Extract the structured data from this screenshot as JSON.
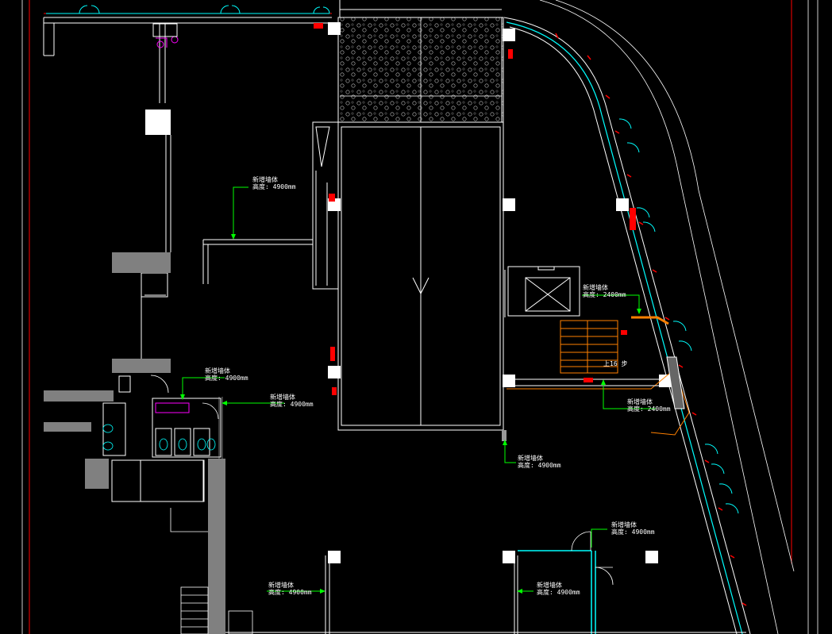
{
  "annotations": [
    {
      "id": "a1",
      "line1": "新增墙体",
      "line2": "高度: 4900mm"
    },
    {
      "id": "a2",
      "line1": "新增墙体",
      "line2": "高度: 2400mm"
    },
    {
      "id": "a3",
      "line1": "新增墙体",
      "line2": "高度: 4900mm"
    },
    {
      "id": "a4",
      "line1": "新增墙体",
      "line2": "高度: 4900mm"
    },
    {
      "id": "a5",
      "line1": "新增墙体",
      "line2": "高度: 2400mm"
    },
    {
      "id": "a6",
      "line1": "新增墙体",
      "line2": "高度: 4900mm"
    },
    {
      "id": "a7",
      "line1": "新增墙体",
      "line2": "高度: 4900mm"
    },
    {
      "id": "a8",
      "line1": "新增墙体",
      "line2": "高度: 4900mm"
    },
    {
      "id": "a9",
      "line1": "新增墙体",
      "line2": "高度: 4900mm"
    }
  ],
  "stair_label": "上16 步",
  "colors": {
    "background": "#000000",
    "wall": "#ffffff",
    "annotation_leader": "#00ff00",
    "glass": "#00ffff",
    "boundary": "#ff0000",
    "fixture": "#ff00ff",
    "stair": "#ff8000",
    "column": "#ffffff",
    "shaft": "#808080"
  }
}
